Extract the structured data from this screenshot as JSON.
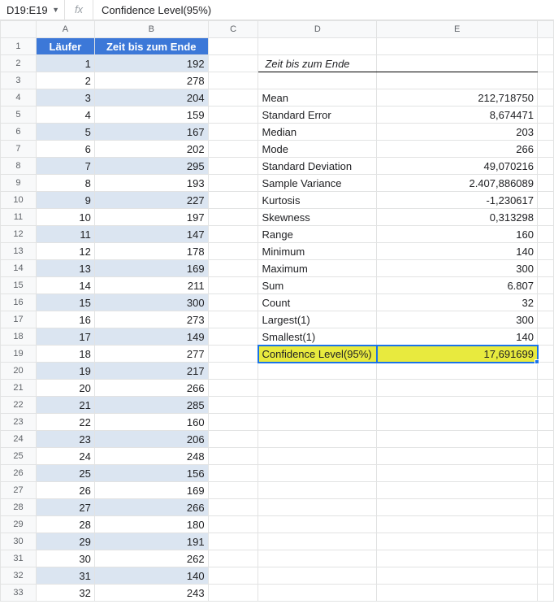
{
  "formula_bar": {
    "cell_ref": "D19:E19",
    "fx_label": "fx",
    "formula": "Confidence Level(95%)"
  },
  "columns": [
    "A",
    "B",
    "C",
    "D",
    "E"
  ],
  "data_headers": {
    "A": "Läufer",
    "B": "Zeit bis zum Ende"
  },
  "stats_title": "Zeit bis zum Ende",
  "runners": [
    {
      "n": "1",
      "t": "192"
    },
    {
      "n": "2",
      "t": "278"
    },
    {
      "n": "3",
      "t": "204"
    },
    {
      "n": "4",
      "t": "159"
    },
    {
      "n": "5",
      "t": "167"
    },
    {
      "n": "6",
      "t": "202"
    },
    {
      "n": "7",
      "t": "295"
    },
    {
      "n": "8",
      "t": "193"
    },
    {
      "n": "9",
      "t": "227"
    },
    {
      "n": "10",
      "t": "197"
    },
    {
      "n": "11",
      "t": "147"
    },
    {
      "n": "12",
      "t": "178"
    },
    {
      "n": "13",
      "t": "169"
    },
    {
      "n": "14",
      "t": "211"
    },
    {
      "n": "15",
      "t": "300"
    },
    {
      "n": "16",
      "t": "273"
    },
    {
      "n": "17",
      "t": "149"
    },
    {
      "n": "18",
      "t": "277"
    },
    {
      "n": "19",
      "t": "217"
    },
    {
      "n": "20",
      "t": "266"
    },
    {
      "n": "21",
      "t": "285"
    },
    {
      "n": "22",
      "t": "160"
    },
    {
      "n": "23",
      "t": "206"
    },
    {
      "n": "24",
      "t": "248"
    },
    {
      "n": "25",
      "t": "156"
    },
    {
      "n": "26",
      "t": "169"
    },
    {
      "n": "27",
      "t": "266"
    },
    {
      "n": "28",
      "t": "180"
    },
    {
      "n": "29",
      "t": "191"
    },
    {
      "n": "30",
      "t": "262"
    },
    {
      "n": "31",
      "t": "140"
    },
    {
      "n": "32",
      "t": "243"
    }
  ],
  "stats": [
    {
      "label": "Mean",
      "value": "212,718750"
    },
    {
      "label": "Standard Error",
      "value": "8,674471"
    },
    {
      "label": "Median",
      "value": "203"
    },
    {
      "label": "Mode",
      "value": "266"
    },
    {
      "label": "Standard Deviation",
      "value": "49,070216"
    },
    {
      "label": "Sample Variance",
      "value": "2.407,886089"
    },
    {
      "label": "Kurtosis",
      "value": "-1,230617"
    },
    {
      "label": "Skewness",
      "value": "0,313298"
    },
    {
      "label": "Range",
      "value": "160"
    },
    {
      "label": "Minimum",
      "value": "140"
    },
    {
      "label": "Maximum",
      "value": "300"
    },
    {
      "label": "Sum",
      "value": "6.807"
    },
    {
      "label": "Count",
      "value": "32"
    },
    {
      "label": "Largest(1)",
      "value": "300"
    },
    {
      "label": "Smallest(1)",
      "value": "140"
    },
    {
      "label": "Confidence Level(95%)",
      "value": "17,691699"
    }
  ],
  "selected_row_index": 19,
  "highlight_stats_index": 15,
  "chart_data": {
    "type": "table",
    "note": "Descriptive statistics table alongside raw data; no graphical chart present",
    "raw_series": {
      "name": "Zeit bis zum Ende",
      "x": [
        1,
        2,
        3,
        4,
        5,
        6,
        7,
        8,
        9,
        10,
        11,
        12,
        13,
        14,
        15,
        16,
        17,
        18,
        19,
        20,
        21,
        22,
        23,
        24,
        25,
        26,
        27,
        28,
        29,
        30,
        31,
        32
      ],
      "values": [
        192,
        278,
        204,
        159,
        167,
        202,
        295,
        193,
        227,
        197,
        147,
        178,
        169,
        211,
        300,
        273,
        149,
        277,
        217,
        266,
        285,
        160,
        206,
        248,
        156,
        169,
        266,
        180,
        191,
        262,
        140,
        243
      ]
    },
    "statistics": {
      "Mean": 212.71875,
      "Standard Error": 8.674471,
      "Median": 203,
      "Mode": 266,
      "Standard Deviation": 49.070216,
      "Sample Variance": 2407.886089,
      "Kurtosis": -1.230617,
      "Skewness": 0.313298,
      "Range": 160,
      "Minimum": 140,
      "Maximum": 300,
      "Sum": 6807,
      "Count": 32,
      "Largest(1)": 300,
      "Smallest(1)": 140,
      "Confidence Level (95%)": 17.691699
    }
  }
}
